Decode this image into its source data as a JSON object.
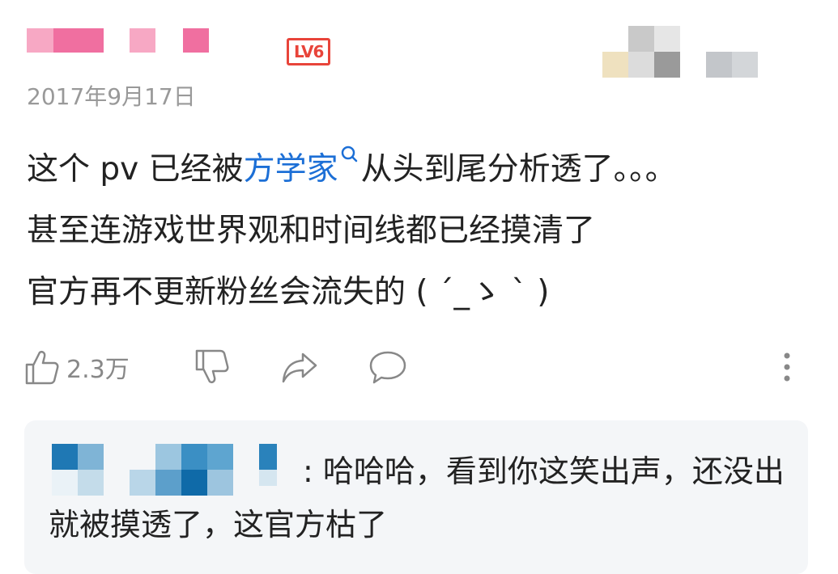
{
  "post": {
    "level_badge": "LV6",
    "date": "2017年9月17日",
    "content": {
      "line1_before": "这个 pv 已经被",
      "topic_link": "方学家",
      "line1_after": "从头到尾分析透了。。。",
      "line2": "甚至连游戏世界观和时间线都已经摸清了",
      "line3": "官方再不更新粉丝会流失的 ( ´_ゝ ` )"
    },
    "actions": {
      "like_count": "2.3万"
    }
  },
  "reply": {
    "text": ": 哈哈哈，看到你这笑出声，还没出就被摸透了，这官方枯了"
  },
  "icons": {
    "topic": "search-icon",
    "like": "thumbs-up-icon",
    "dislike": "thumbs-down-icon",
    "share": "share-icon",
    "comment": "comment-icon",
    "more": "more-vertical-icon"
  },
  "colors": {
    "link": "#1c6fd6",
    "level_badge": "#e8443a",
    "muted": "#999999",
    "reply_background": "#f4f6f8"
  }
}
